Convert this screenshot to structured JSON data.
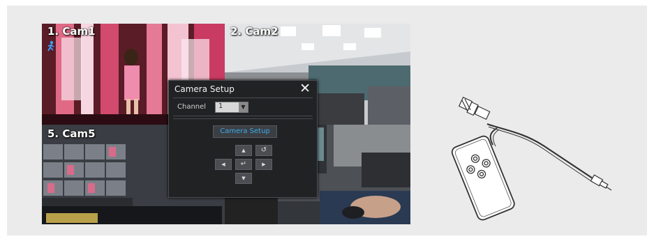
{
  "cameras": [
    {
      "label": "1. Cam1"
    },
    {
      "label": "2. Cam2"
    },
    {
      "label": "5. Cam5"
    }
  ],
  "dialog": {
    "title": "Camera Setup",
    "close_icon": "close-icon",
    "channel_label": "Channel",
    "channel_value": "1",
    "camera_setup_button": "Camera Setup",
    "nav_buttons": {
      "up": "▲",
      "refresh": "↺",
      "left": "◀",
      "enter": "↵",
      "right": "▶",
      "down": "▼"
    }
  },
  "illustration": {
    "item": "remote-control-with-cable"
  },
  "colors": {
    "frame_bg": "#ebebeb",
    "dialog_bg": "#202224",
    "accent": "#3fa9e8"
  }
}
